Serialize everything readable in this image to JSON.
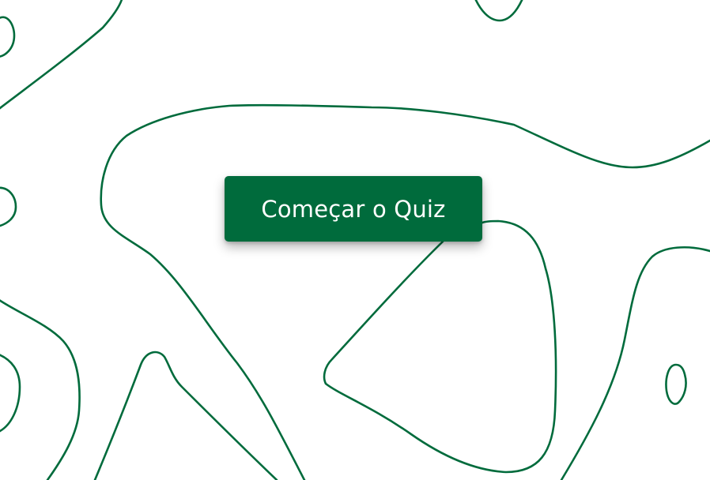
{
  "background": {
    "pattern": "topographic-contour-lines",
    "line_color": "#006b3c",
    "fill_color": "#ffffff"
  },
  "start_button": {
    "label": "Começar o Quiz",
    "bg_color": "#006b3c",
    "text_color": "#ffffff"
  }
}
